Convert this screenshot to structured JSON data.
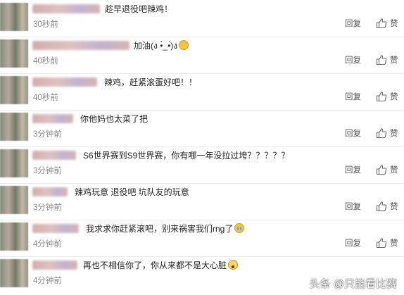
{
  "comments": [
    {
      "text": "趁早退役吧辣鸡！",
      "emoji": "",
      "time": "30秒前",
      "reply": "回复",
      "like": "赞"
    },
    {
      "text": "加油(ง •̀_•́)ง",
      "emoji": "hug",
      "time": "40秒前",
      "reply": "回复",
      "like": "赞"
    },
    {
      "text": "辣鸡，赶紧滚蛋好吧！！",
      "emoji": "",
      "time": "40秒前",
      "reply": "回复",
      "like": "赞"
    },
    {
      "text": "你他妈也太菜了把",
      "emoji": "",
      "time": "3分钟前",
      "reply": "回复",
      "like": "赞"
    },
    {
      "text": "S6世界赛到S9世界赛，你有哪一年没拉过垮？？？？？",
      "emoji": "",
      "time": "3分钟前",
      "reply": "回复",
      "like": "赞"
    },
    {
      "text": "辣鸡玩意 退役吧 坑队友的玩意",
      "emoji": "",
      "time": "3分钟前",
      "reply": "回复",
      "like": "赞"
    },
    {
      "text": "我求求你赶紧滚吧，别来祸害我们rng了",
      "emoji": "cry",
      "time": "4分钟前",
      "reply": "回复",
      "like": "赞"
    },
    {
      "text": "再也不相信你了，你从来都不是大心脏",
      "emoji": "fear",
      "time": "4分钟前",
      "reply": "回复",
      "like": "赞"
    }
  ],
  "watermark": "头条 @只能看比赛"
}
